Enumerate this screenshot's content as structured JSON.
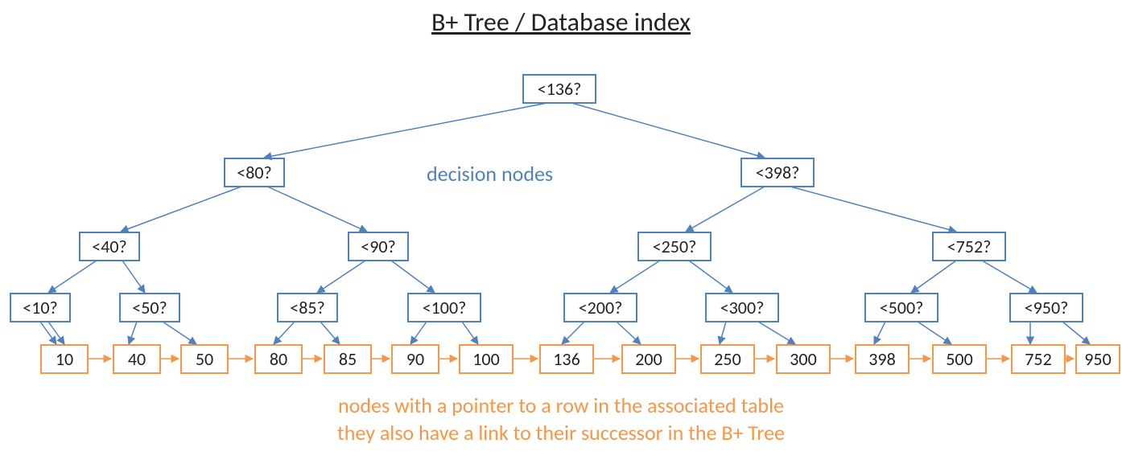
{
  "title": "B+ Tree / Database index",
  "annotations": {
    "decision_label": "decision nodes",
    "leaf_label_line1": "nodes with a pointer to a row in the associated table",
    "leaf_label_line2": "they also have a link to their successor in the B+ Tree"
  },
  "colors": {
    "decision": "#4f81bd",
    "leaf": "#f79646"
  },
  "tree": {
    "root": {
      "label": "<136?"
    },
    "l2": [
      {
        "label": "<80?"
      },
      {
        "label": "<398?"
      }
    ],
    "l3": [
      {
        "label": "<40?"
      },
      {
        "label": "<90?"
      },
      {
        "label": "<250?"
      },
      {
        "label": "<752?"
      }
    ],
    "l4": [
      {
        "label": "<10?"
      },
      {
        "label": "<50?"
      },
      {
        "label": "<85?"
      },
      {
        "label": "<100?"
      },
      {
        "label": "<200?"
      },
      {
        "label": "<300?"
      },
      {
        "label": "<500?"
      },
      {
        "label": "<950?"
      }
    ],
    "leaves": [
      {
        "value": "10"
      },
      {
        "value": "40"
      },
      {
        "value": "50"
      },
      {
        "value": "80"
      },
      {
        "value": "85"
      },
      {
        "value": "90"
      },
      {
        "value": "100"
      },
      {
        "value": "136"
      },
      {
        "value": "200"
      },
      {
        "value": "250"
      },
      {
        "value": "300"
      },
      {
        "value": "398"
      },
      {
        "value": "500"
      },
      {
        "value": "752"
      },
      {
        "value": "950"
      }
    ]
  }
}
